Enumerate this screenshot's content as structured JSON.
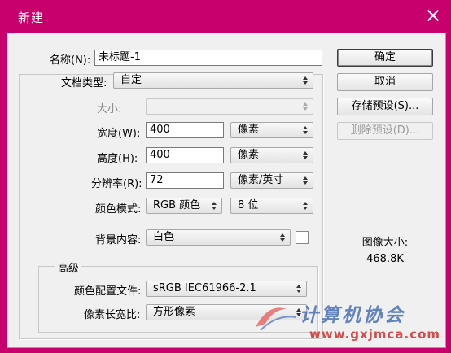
{
  "window": {
    "title": "新建"
  },
  "form": {
    "name": {
      "label": "名称(N):",
      "value": "未标题-1"
    },
    "preset": {
      "label": "文档类型:",
      "value": "自定"
    },
    "size": {
      "label": "大小:",
      "value": ""
    },
    "width": {
      "label": "宽度(W):",
      "value": "400",
      "unit": "像素"
    },
    "height": {
      "label": "高度(H):",
      "value": "400",
      "unit": "像素"
    },
    "resolution": {
      "label": "分辨率(R):",
      "value": "72",
      "unit": "像素/英寸"
    },
    "color_mode": {
      "label": "颜色模式:",
      "value": "RGB 颜色",
      "depth": "8 位"
    },
    "background": {
      "label": "背景内容:",
      "value": "白色"
    },
    "advanced": {
      "legend": "高级",
      "color_profile": {
        "label": "颜色配置文件:",
        "value": "sRGB IEC61966-2.1"
      },
      "pixel_aspect": {
        "label": "像素长宽比:",
        "value": "方形像素"
      }
    }
  },
  "buttons": {
    "ok": "确定",
    "cancel": "取消",
    "save_preset": "存储预设(S)...",
    "delete_preset": "删除预设(D)..."
  },
  "image_size": {
    "label": "图像大小:",
    "value": "468.8K"
  },
  "watermark": {
    "text": "计算机协会",
    "url": "www.gxjmca.com"
  },
  "colors": {
    "titlebar": "#c8006e",
    "dialog_bg": "#f0f0f0"
  }
}
